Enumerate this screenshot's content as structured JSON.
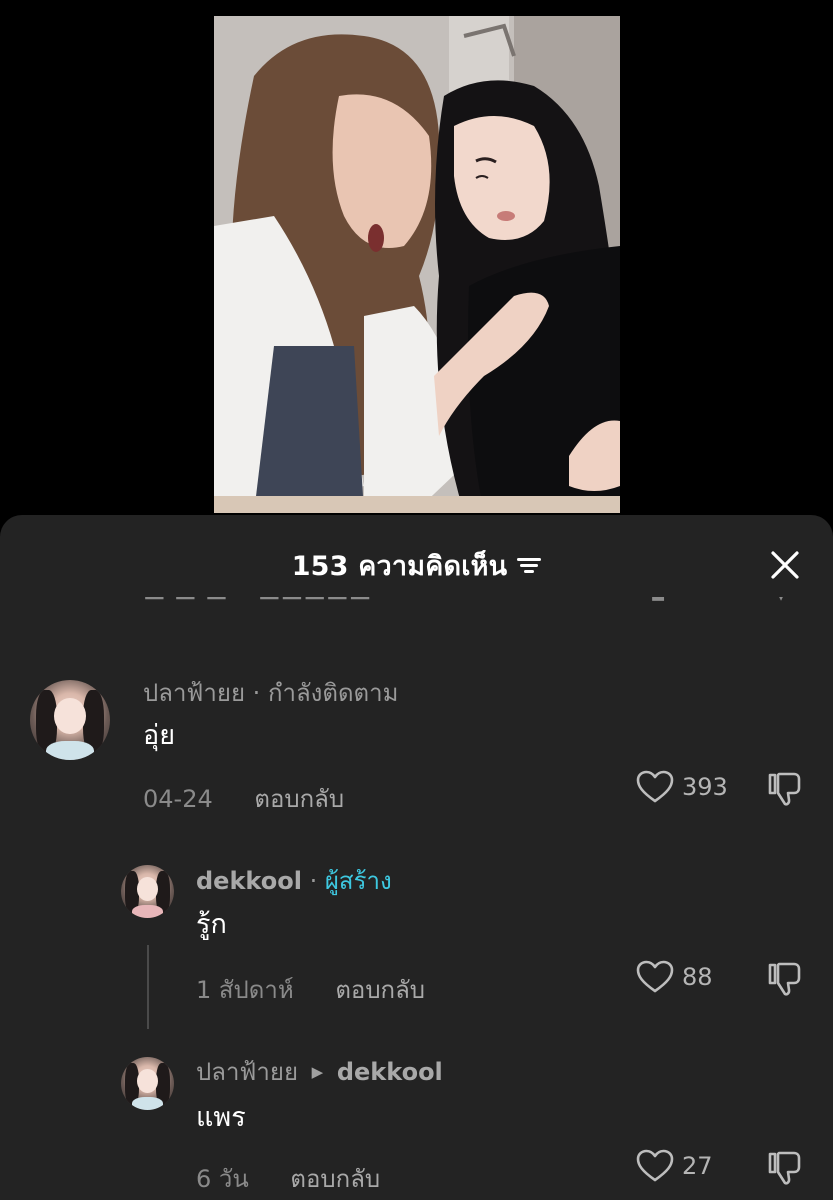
{
  "header": {
    "title": "153 ความคิดเห็น",
    "filter_icon": "filter-icon",
    "close_icon": "close-icon"
  },
  "comments": [
    {
      "username": "ปลาฟ้ายย",
      "separator": "·",
      "status": "กำลังติดตาม",
      "text": "อุ่ย",
      "date": "04-24",
      "reply_label": "ตอบกลับ",
      "likes": "393"
    },
    {
      "username": "dekkool",
      "separator": "·",
      "badge": "ผู้สร้าง",
      "text": "รู้ก",
      "date": "1 สัปดาห์",
      "reply_label": "ตอบกลับ",
      "likes": "88"
    },
    {
      "username": "ปลาฟ้ายย",
      "reply_to": "dekkool",
      "text": "แพร",
      "date": "6 วัน",
      "reply_label": "ตอบกลับ",
      "likes": "27"
    }
  ],
  "colors": {
    "sheet_bg": "#232323",
    "creator_badge": "#3ec8e0",
    "muted_text": "#8a8a8a"
  }
}
